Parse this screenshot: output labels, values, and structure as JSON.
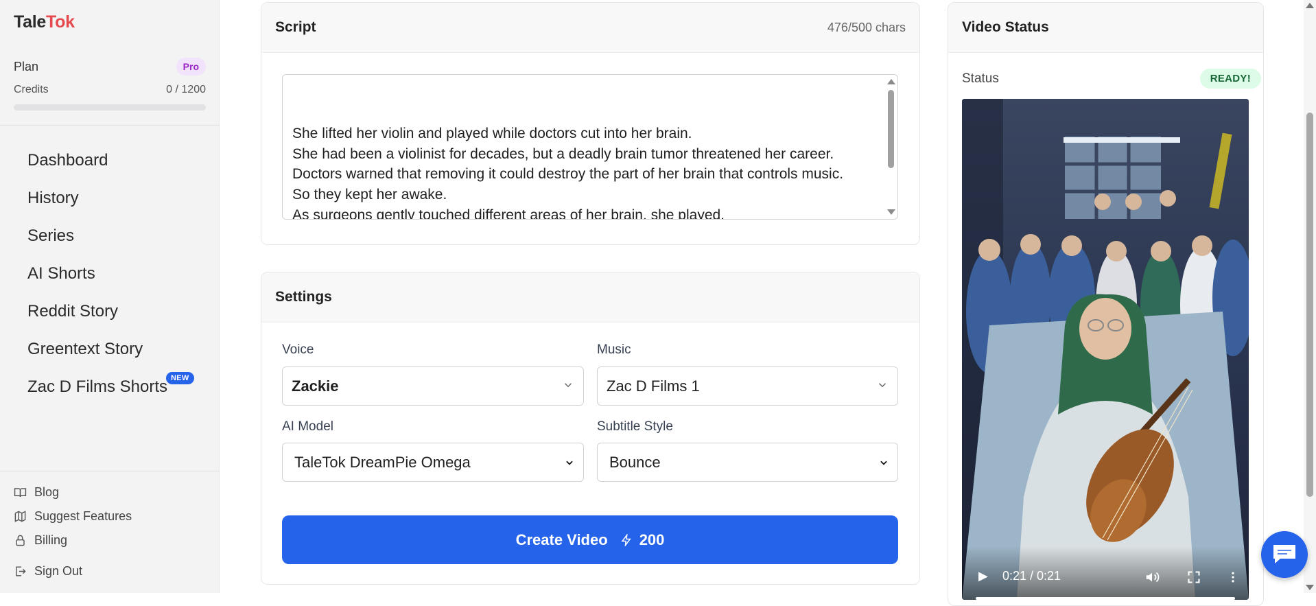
{
  "app": {
    "logo_part1": "Tale",
    "logo_part2": "Tok"
  },
  "plan": {
    "label": "Plan",
    "tier": "Pro",
    "credits_label": "Credits",
    "credits_value": "0 / 1200",
    "credits_fraction": 0
  },
  "nav": {
    "items": [
      {
        "label": "Dashboard"
      },
      {
        "label": "History"
      },
      {
        "label": "Series"
      },
      {
        "label": "AI Shorts"
      },
      {
        "label": "Reddit Story"
      },
      {
        "label": "Greentext Story"
      },
      {
        "label": "Zac D Films Shorts",
        "badge": "NEW"
      }
    ]
  },
  "footer": {
    "blog": "Blog",
    "suggest": "Suggest Features",
    "billing": "Billing",
    "signout": "Sign Out"
  },
  "script": {
    "title": "Script",
    "char_count": "476/500 chars",
    "text": "She lifted her violin and played while doctors cut into her brain.\nShe had been a violinist for decades, but a deadly brain tumor threatened her career.\nDoctors warned that removing it could destroy the part of her brain that controls music.\nSo they kept her awake.\nAs surgeons gently touched different areas of her brain, she played."
  },
  "settings": {
    "title": "Settings",
    "voice_label": "Voice",
    "voice_value": "Zackie",
    "music_label": "Music",
    "music_value": "Zac D Films 1",
    "model_label": "AI Model",
    "model_value": "TaleTok DreamPie Omega",
    "subtitle_label": "Subtitle Style",
    "subtitle_value": "Bounce",
    "create_label": "Create Video",
    "create_cost": "200"
  },
  "video_status": {
    "title": "Video Status",
    "status_label": "Status",
    "status_value": "READY!",
    "time": "0:21 / 0:21"
  },
  "colors": {
    "accent": "#2563eb",
    "logo_red": "#e5484d",
    "pro_purple": "#9b26c4",
    "ready_green": "#166534"
  }
}
